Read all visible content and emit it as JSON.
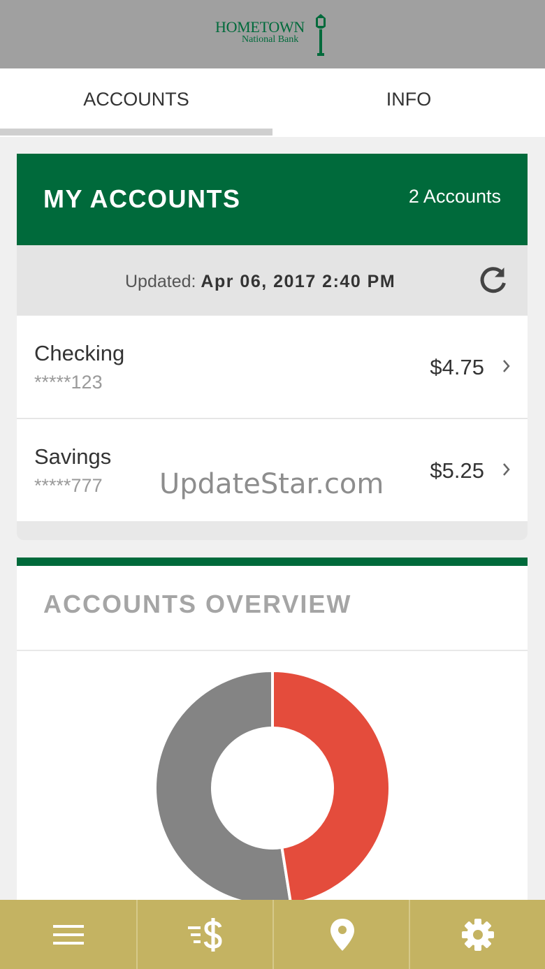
{
  "brand": {
    "line1": "HOMETOWN",
    "line2": "National Bank",
    "color": "#006a3b"
  },
  "tabs": [
    {
      "label": "ACCOUNTS",
      "active": true
    },
    {
      "label": "INFO",
      "active": false
    }
  ],
  "accounts_card": {
    "title": "MY ACCOUNTS",
    "count": "2 Accounts",
    "updated_label": "Updated:",
    "updated_value": "Apr 06, 2017 2:40 PM",
    "refresh_icon": "refresh-icon",
    "items": [
      {
        "name": "Checking",
        "number": "*****123",
        "balance": "$4.75"
      },
      {
        "name": "Savings",
        "number": "*****777",
        "balance": "$5.25"
      }
    ]
  },
  "watermark": "UpdateStar.com",
  "overview": {
    "title": "ACCOUNTS OVERVIEW"
  },
  "chart_data": {
    "type": "pie",
    "style": "donut",
    "values": [
      5.25,
      4.75
    ],
    "colors": [
      "#848484",
      "#e44c3c"
    ]
  },
  "bottom_nav": [
    {
      "icon": "menu-icon"
    },
    {
      "icon": "transfer-money-icon"
    },
    {
      "icon": "location-pin-icon"
    },
    {
      "icon": "gear-icon"
    }
  ],
  "colors": {
    "primary_green": "#006a3b",
    "nav_gold": "#c4b362",
    "header_gray": "#a0a0a0"
  }
}
